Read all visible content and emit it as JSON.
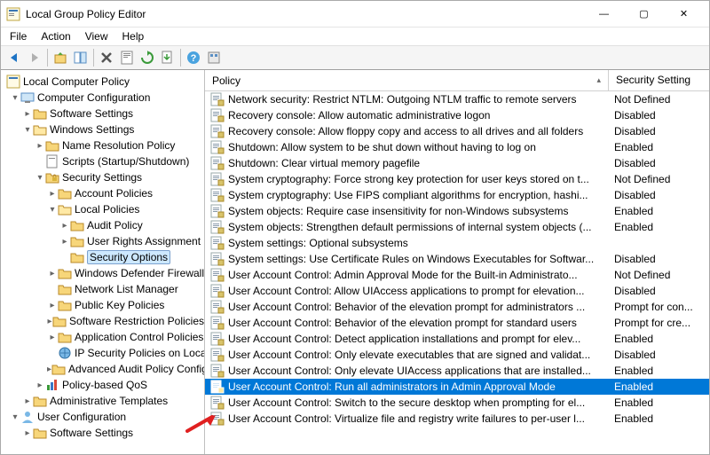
{
  "window": {
    "title": "Local Group Policy Editor",
    "min": "—",
    "max": "▢",
    "close": "✕"
  },
  "menu": {
    "file": "File",
    "action": "Action",
    "view": "View",
    "help": "Help"
  },
  "tree": {
    "root": "Local Computer Policy",
    "cc": "Computer Configuration",
    "cc_sw": "Software Settings",
    "cc_win": "Windows Settings",
    "cc_nrp": "Name Resolution Policy",
    "cc_scripts": "Scripts (Startup/Shutdown)",
    "cc_sec": "Security Settings",
    "cc_ap": "Account Policies",
    "cc_lp": "Local Policies",
    "cc_audit": "Audit Policy",
    "cc_ura": "User Rights Assignment",
    "cc_so": "Security Options",
    "cc_wdf": "Windows Defender Firewall",
    "cc_nlm": "Network List Manager",
    "cc_pkp": "Public Key Policies",
    "cc_srp": "Software Restriction Policies",
    "cc_acp": "Application Control Policies",
    "cc_ipsec": "IP Security Policies on Local Computer",
    "cc_aap": "Advanced Audit Policy Configuration",
    "cc_qos": "Policy-based QoS",
    "cc_at": "Administrative Templates",
    "uc": "User Configuration",
    "uc_sw": "Software Settings"
  },
  "headers": {
    "policy": "Policy",
    "setting": "Security Setting"
  },
  "policies": [
    {
      "policy": "Network security: Restrict NTLM: Outgoing NTLM traffic to remote servers",
      "setting": "Not Defined"
    },
    {
      "policy": "Recovery console: Allow automatic administrative logon",
      "setting": "Disabled"
    },
    {
      "policy": "Recovery console: Allow floppy copy and access to all drives and all folders",
      "setting": "Disabled"
    },
    {
      "policy": "Shutdown: Allow system to be shut down without having to log on",
      "setting": "Enabled"
    },
    {
      "policy": "Shutdown: Clear virtual memory pagefile",
      "setting": "Disabled"
    },
    {
      "policy": "System cryptography: Force strong key protection for user keys stored on t...",
      "setting": "Not Defined"
    },
    {
      "policy": "System cryptography: Use FIPS compliant algorithms for encryption, hashi...",
      "setting": "Disabled"
    },
    {
      "policy": "System objects: Require case insensitivity for non-Windows subsystems",
      "setting": "Enabled"
    },
    {
      "policy": "System objects: Strengthen default permissions of internal system objects (...",
      "setting": "Enabled"
    },
    {
      "policy": "System settings: Optional subsystems",
      "setting": ""
    },
    {
      "policy": "System settings: Use Certificate Rules on Windows Executables for Softwar...",
      "setting": "Disabled"
    },
    {
      "policy": "User Account Control: Admin Approval Mode for the Built-in Administrato...",
      "setting": "Not Defined"
    },
    {
      "policy": "User Account Control: Allow UIAccess applications to prompt for elevation...",
      "setting": "Disabled"
    },
    {
      "policy": "User Account Control: Behavior of the elevation prompt for administrators ...",
      "setting": "Prompt for con..."
    },
    {
      "policy": "User Account Control: Behavior of the elevation prompt for standard users",
      "setting": "Prompt for cre..."
    },
    {
      "policy": "User Account Control: Detect application installations and prompt for elev...",
      "setting": "Enabled"
    },
    {
      "policy": "User Account Control: Only elevate executables that are signed and validat...",
      "setting": "Disabled"
    },
    {
      "policy": "User Account Control: Only elevate UIAccess applications that are installed...",
      "setting": "Enabled"
    },
    {
      "policy": "User Account Control: Run all administrators in Admin Approval Mode",
      "setting": "Enabled",
      "selected": true
    },
    {
      "policy": "User Account Control: Switch to the secure desktop when prompting for el...",
      "setting": "Enabled"
    },
    {
      "policy": "User Account Control: Virtualize file and registry write failures to per-user l...",
      "setting": "Enabled"
    }
  ]
}
